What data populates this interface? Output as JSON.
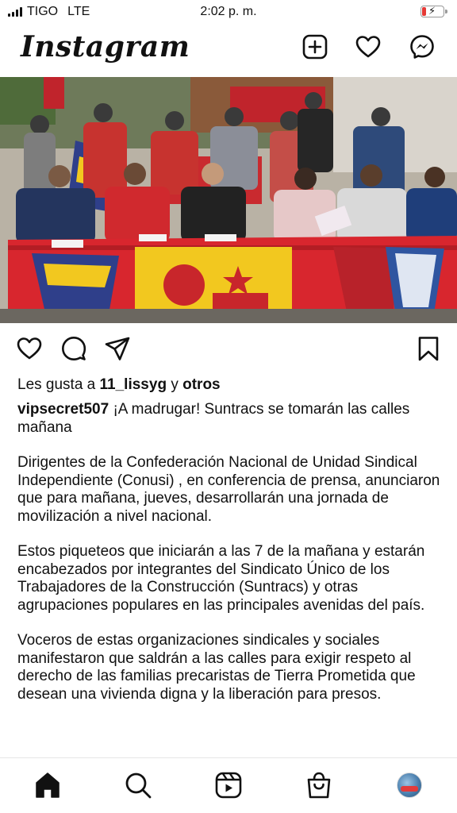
{
  "status_bar": {
    "carrier": "TIGO",
    "network": "LTE",
    "time": "2:02 p. m.",
    "battery_level": 0.18,
    "battery_color": "#e53935"
  },
  "header": {
    "logo": "Instagram",
    "icons": [
      "add-post-icon",
      "heart-icon",
      "messenger-icon"
    ]
  },
  "post": {
    "image_colors": {
      "tablecloth": "#d8262e",
      "yellow_flag": "#f2c81f",
      "blue_banner": "#2f3f8a"
    },
    "actions": [
      "heart-icon",
      "comment-icon",
      "share-icon",
      "bookmark-icon"
    ],
    "likes": {
      "prefix": "Les gusta a",
      "user": "11_lissyg",
      "connector": "y",
      "others": "otros"
    },
    "caption": {
      "username": "vipsecret507",
      "headline": "¡A madrugar! Suntracs se tomarán las calles mañana",
      "paragraphs": [
        "Dirigentes de la Confederación Nacional de Unidad Sindical Independiente (Conusi) , en conferencia de prensa, anunciaron que para mañana, jueves, desarrollarán una jornada de movilización a nivel nacional.",
        "Estos piqueteos que iniciarán a las 7 de la mañana y estarán encabezados por integrantes del Sindicato Único de los Trabajadores de la Construcción (Suntracs) y otras agrupaciones populares en las principales avenidas del país.",
        "Voceros de estas organizaciones sindicales y sociales manifestaron que saldrán a las calles para  exigir respeto al derecho de las familias precaristas de Tierra Prometida que desean una vivienda digna y la liberación para presos."
      ]
    }
  },
  "bottom_nav": {
    "items": [
      "home-icon",
      "search-icon",
      "reels-icon",
      "shop-icon",
      "profile-avatar"
    ]
  }
}
